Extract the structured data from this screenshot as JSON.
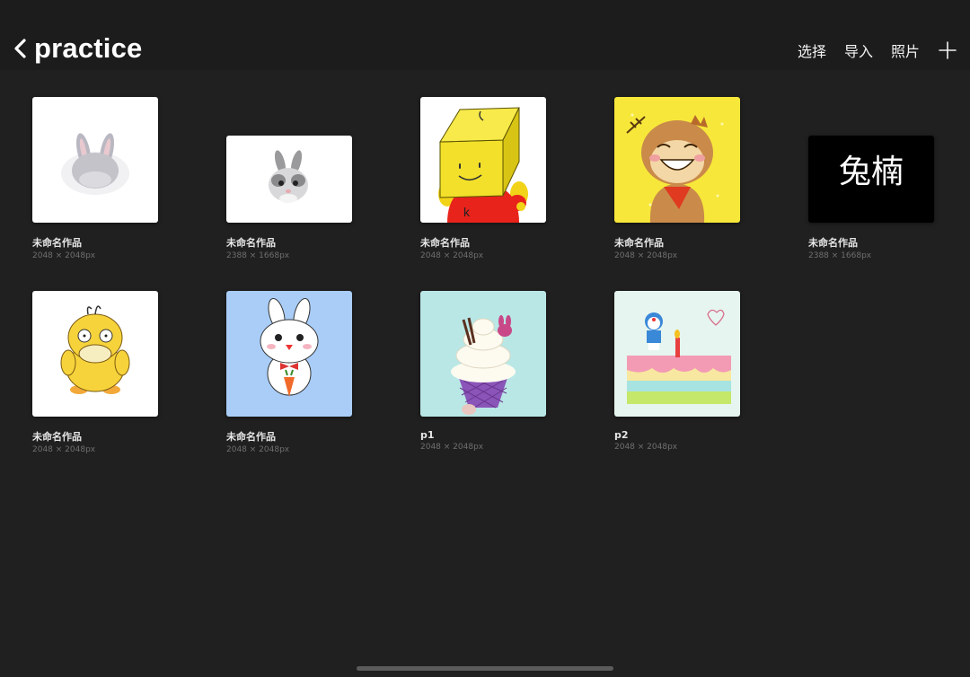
{
  "header": {
    "title": "practice",
    "actions": {
      "select": "选择",
      "import": "导入",
      "photos": "照片"
    }
  },
  "artworks": [
    {
      "name": "未命名作品",
      "size": "2048 × 2048px",
      "thumb": "bunny-back"
    },
    {
      "name": "未命名作品",
      "size": "2388 × 1668px",
      "thumb": "bunny-face"
    },
    {
      "name": "未命名作品",
      "size": "2048 × 2048px",
      "thumb": "box-head"
    },
    {
      "name": "未命名作品",
      "size": "2048 × 2048px",
      "thumb": "monkey"
    },
    {
      "name": "未命名作品",
      "size": "2388 × 1668px",
      "thumb": "calligraphy",
      "text": "兔楠"
    },
    {
      "name": "未命名作品",
      "size": "2048 × 2048px",
      "thumb": "psyduck"
    },
    {
      "name": "未命名作品",
      "size": "2048 × 2048px",
      "thumb": "white-bunny"
    },
    {
      "name": "p1",
      "size": "2048 × 2048px",
      "thumb": "ice-cream"
    },
    {
      "name": "p2",
      "size": "2048 × 2048px",
      "thumb": "birthday-cake"
    }
  ],
  "colors": {
    "background": "#202020",
    "header": "#1c1c1c",
    "text": "#ffffff",
    "subtext": "#6f6f6f"
  }
}
